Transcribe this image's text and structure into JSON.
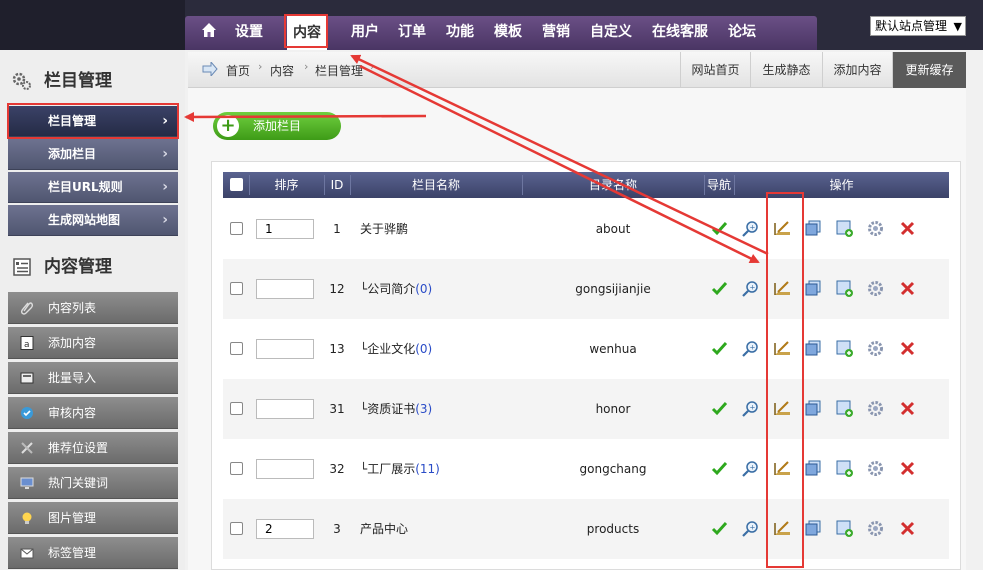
{
  "topnav": {
    "items": [
      "设置",
      "内容",
      "用户",
      "订单",
      "功能",
      "模板",
      "营销",
      "自定义",
      "在线客服",
      "论坛"
    ],
    "active": "内容",
    "site_select": "默认站点管理"
  },
  "sidebar": {
    "section1": "栏目管理",
    "sub_items": [
      "栏目管理",
      "添加栏目",
      "栏目URL规则",
      "生成网站地图"
    ],
    "section2": "内容管理",
    "content_items": [
      "内容列表",
      "添加内容",
      "批量导入",
      "审核内容",
      "推荐位设置",
      "热门关键词",
      "图片管理",
      "标签管理"
    ]
  },
  "breadcrumb": [
    "首页",
    "内容",
    "栏目管理"
  ],
  "actions": [
    "网站首页",
    "生成静态",
    "添加内容",
    "更新缓存"
  ],
  "add_button": "添加栏目",
  "table": {
    "headers": [
      "排序",
      "ID",
      "栏目名称",
      "目录名称",
      "导航",
      "操作"
    ],
    "rows": [
      {
        "sort": "1",
        "id": "1",
        "name": "关于骅鹏",
        "count": "",
        "dir": "about"
      },
      {
        "sort": "",
        "id": "12",
        "name": "└公司简介",
        "count": "(0)",
        "dir": "gongsijianjie"
      },
      {
        "sort": "",
        "id": "13",
        "name": "└企业文化",
        "count": "(0)",
        "dir": "wenhua"
      },
      {
        "sort": "",
        "id": "31",
        "name": "└资质证书",
        "count": "(3)",
        "dir": "honor"
      },
      {
        "sort": "",
        "id": "32",
        "name": "└工厂展示",
        "count": "(11)",
        "dir": "gongchang"
      },
      {
        "sort": "2",
        "id": "3",
        "name": "产品中心",
        "count": "",
        "dir": "products"
      }
    ]
  },
  "colors": {
    "nav_purple": "#5a4075",
    "sidebar_blue": "#505670",
    "header_blue": "#4a5280",
    "highlight_red": "#e53935",
    "add_green": "#4cae22"
  }
}
